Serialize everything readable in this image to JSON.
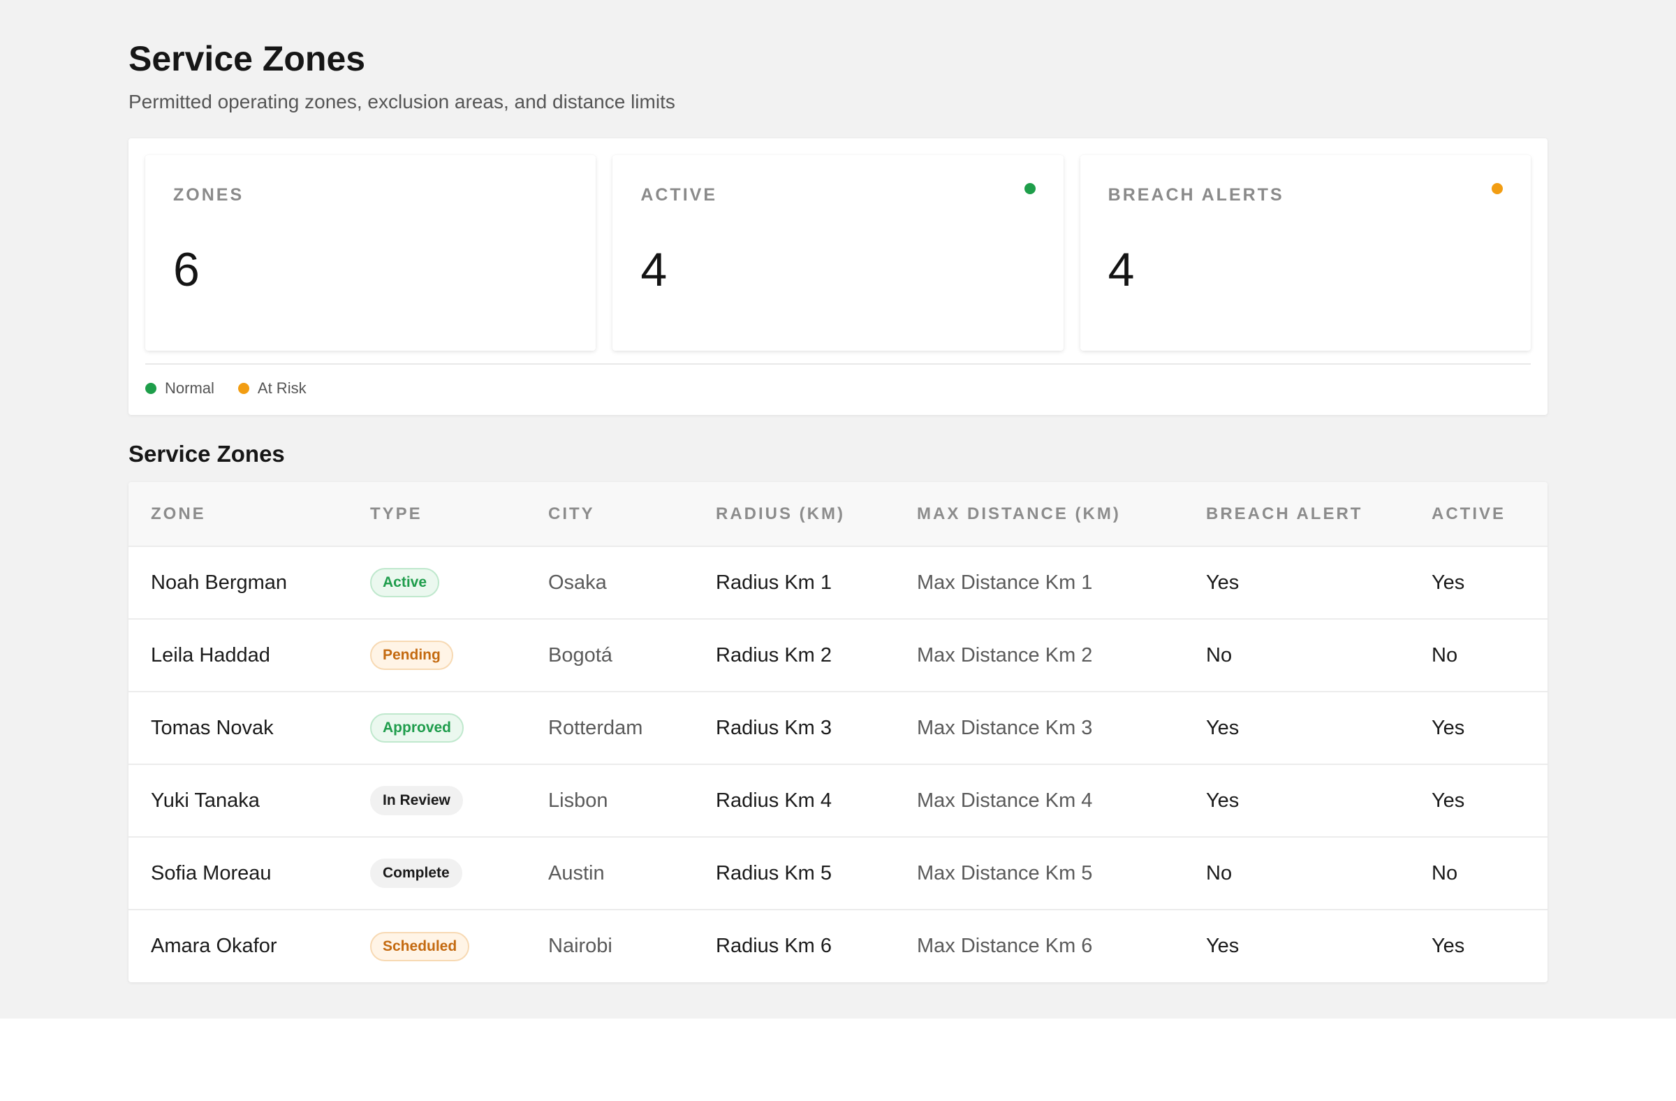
{
  "header": {
    "title": "Service Zones",
    "subtitle": "Permitted operating zones, exclusion areas, and distance limits"
  },
  "stats": {
    "cards": [
      {
        "label": "ZONES",
        "value": "6",
        "dot_color": ""
      },
      {
        "label": "ACTIVE",
        "value": "4",
        "dot_color": "#1e9e4a"
      },
      {
        "label": "BREACH ALERTS",
        "value": "4",
        "dot_color": "#f29d12"
      }
    ],
    "legend": [
      {
        "label": "Normal",
        "color": "#1e9e4a"
      },
      {
        "label": "At Risk",
        "color": "#f29d12"
      }
    ]
  },
  "table": {
    "title": "Service Zones",
    "columns": [
      "ZONE",
      "TYPE",
      "CITY",
      "RADIUS (KM)",
      "MAX DISTANCE (KM)",
      "BREACH ALERT",
      "ACTIVE"
    ],
    "rows": [
      {
        "zone": "Noah Bergman",
        "type": "Active",
        "type_style": "green",
        "city": "Osaka",
        "radius": "Radius Km 1",
        "max_distance": "Max Distance Km 1",
        "breach_alert": "Yes",
        "active": "Yes"
      },
      {
        "zone": "Leila Haddad",
        "type": "Pending",
        "type_style": "orange",
        "city": "Bogotá",
        "radius": "Radius Km 2",
        "max_distance": "Max Distance Km 2",
        "breach_alert": "No",
        "active": "No"
      },
      {
        "zone": "Tomas Novak",
        "type": "Approved",
        "type_style": "green",
        "city": "Rotterdam",
        "radius": "Radius Km 3",
        "max_distance": "Max Distance Km 3",
        "breach_alert": "Yes",
        "active": "Yes"
      },
      {
        "zone": "Yuki Tanaka",
        "type": "In Review",
        "type_style": "gray",
        "city": "Lisbon",
        "radius": "Radius Km 4",
        "max_distance": "Max Distance Km 4",
        "breach_alert": "Yes",
        "active": "Yes"
      },
      {
        "zone": "Sofia Moreau",
        "type": "Complete",
        "type_style": "gray",
        "city": "Austin",
        "radius": "Radius Km 5",
        "max_distance": "Max Distance Km 5",
        "breach_alert": "No",
        "active": "No"
      },
      {
        "zone": "Amara Okafor",
        "type": "Scheduled",
        "type_style": "orange",
        "city": "Nairobi",
        "radius": "Radius Km 6",
        "max_distance": "Max Distance Km 6",
        "breach_alert": "Yes",
        "active": "Yes"
      }
    ]
  }
}
